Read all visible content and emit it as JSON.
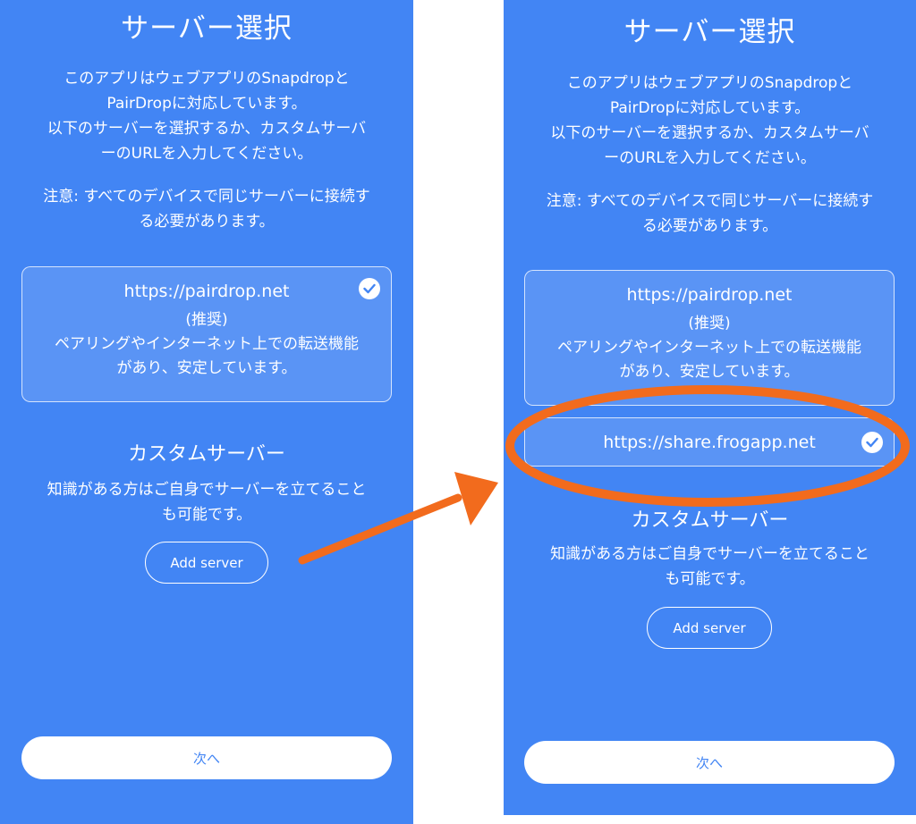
{
  "left_screen": {
    "title": "サーバー選択",
    "description_lines": [
      "このアプリはウェブアプリのSnapdropと",
      "PairDropに対応しています。",
      "以下のサーバーを選択するか、カスタムサーバ",
      "ーのURLを入力してください。"
    ],
    "note_lines": [
      "注意: すべてのデバイスで同じサーバーに接続す",
      "る必要があります。"
    ],
    "server_option": {
      "url": "https://pairdrop.net",
      "recommended": "(推奨)",
      "detail_lines": [
        "ペアリングやインターネット上での転送機能",
        "があり、安定しています。"
      ],
      "selected": true
    },
    "custom_section_title": "カスタムサーバー",
    "custom_desc_lines": [
      "知識がある方はご自身でサーバーを立てること",
      "も可能です。"
    ],
    "add_server_label": "Add server",
    "next_label": "次へ"
  },
  "right_screen": {
    "title": "サーバー選択",
    "description_lines": [
      "このアプリはウェブアプリのSnapdropと",
      "PairDropに対応しています。",
      "以下のサーバーを選択するか、カスタムサーバ",
      "ーのURLを入力してください。"
    ],
    "note_lines": [
      "注意: すべてのデバイスで同じサーバーに接続す",
      "る必要があります。"
    ],
    "server_option": {
      "url": "https://pairdrop.net",
      "recommended": "(推奨)",
      "detail_lines": [
        "ペアリングやインターネット上での転送機能",
        "があり、安定しています。"
      ],
      "selected": false
    },
    "custom_server_option": {
      "url": "https://share.frogapp.net",
      "selected": true
    },
    "custom_section_title": "カスタムサーバー",
    "custom_desc_lines": [
      "知識がある方はご自身でサーバーを立てること",
      "も可能です。"
    ],
    "add_server_label": "Add server",
    "next_label": "次へ"
  },
  "annotation": {
    "arrow_color": "#f26b1d",
    "highlight_color": "#f26b1d"
  },
  "colors": {
    "screen_background": "#4285f4",
    "text": "#ffffff",
    "next_button_text": "#4285f4"
  },
  "icons": {
    "selected_check": "check-circle-icon"
  }
}
